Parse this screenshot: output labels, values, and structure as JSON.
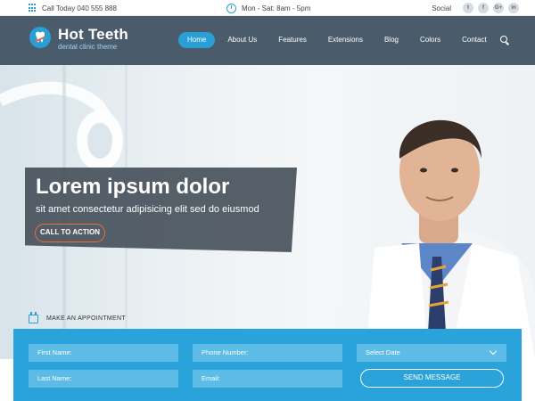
{
  "topbar": {
    "phone_text": "Call Today 040 555 888",
    "hours_text": "Mon - Sat: 8am - 5pm",
    "social_label": "Social",
    "social_icons": [
      {
        "name": "twitter-icon",
        "glyph": "t"
      },
      {
        "name": "facebook-icon",
        "glyph": "f"
      },
      {
        "name": "google-plus-icon",
        "glyph": "G+"
      },
      {
        "name": "linkedin-icon",
        "glyph": "in"
      }
    ]
  },
  "header": {
    "brand": "Hot Teeth",
    "tagline": "dental clinic theme",
    "nav": [
      "Home",
      "About Us",
      "Features",
      "Extensions",
      "Blog",
      "Colors",
      "Contact"
    ],
    "active_nav": "Home"
  },
  "hero": {
    "headline": "Lorem ipsum dolor",
    "subline": "sit amet consectetur adipisicing elit sed do eiusmod",
    "cta_label": "CALL TO ACTION"
  },
  "appointment": {
    "label": "MAKE AN APPOINTMENT",
    "first_name_placeholder": "First Name:",
    "phone_placeholder": "Phone Number:",
    "date_placeholder": "Select Date",
    "last_name_placeholder": "Last Name:",
    "email_placeholder": "Email:",
    "send_label": "SEND MESSAGE"
  },
  "colors": {
    "accent": "#2a9fd6",
    "header_bg": "#4a5b6c",
    "cta_border": "#f06b3a",
    "form_bg": "#2aa3db"
  }
}
